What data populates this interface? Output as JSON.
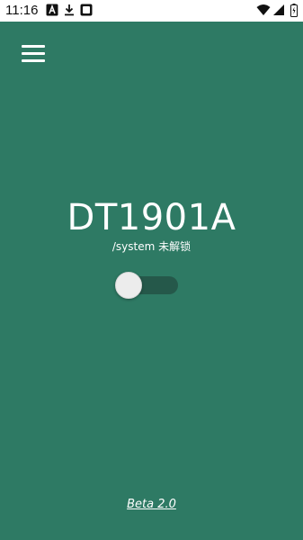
{
  "status_bar": {
    "time": "11:16",
    "left_icons": [
      "text-a-notification-icon",
      "download-icon",
      "blank-notification-icon"
    ],
    "right_icons": [
      "wifi-icon",
      "signal-icon",
      "battery-charging-icon"
    ]
  },
  "menu": {
    "icon": "hamburger-menu-icon"
  },
  "main": {
    "device_model": "DT1901A",
    "system_status": "/system 未解锁"
  },
  "toggle": {
    "state": "off",
    "thumb_color": "#ECECEC",
    "track_color": "#25584A"
  },
  "footer": {
    "version_label": "Beta 2.0"
  },
  "colors": {
    "background": "#2E7A64",
    "status_bar": "#FFFFFF",
    "text": "#FFFFFF"
  }
}
